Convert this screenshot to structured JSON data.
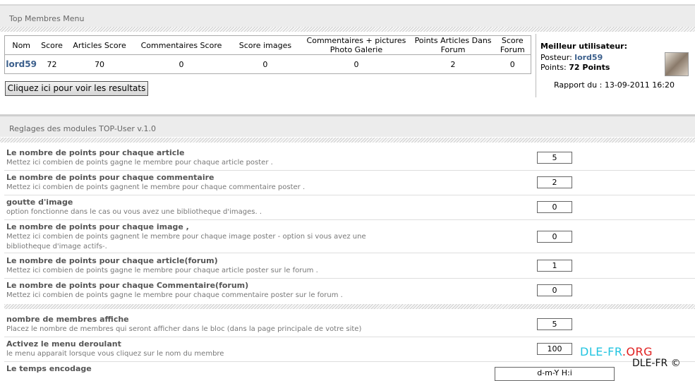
{
  "top_menu": {
    "title": "Top Membres Menu",
    "columns": [
      "Nom",
      "Score",
      "Articles Score",
      "Commentaires Score",
      "Score images",
      "Commentaires + pictures Photo Galerie",
      "Points Articles Dans Forum",
      "Score Forum"
    ],
    "rows": [
      [
        "lord59",
        "72",
        "70",
        "0",
        "0",
        "0",
        "2",
        "0"
      ]
    ],
    "results_button": "Cliquez ici pour voir les resultats",
    "best_user": {
      "heading": "Meilleur utilisateur:",
      "poster_label": "Posteur:",
      "poster_name": "lord59",
      "points_label": "Points:",
      "points_value": "72 Points",
      "report_label": "Rapport du : 13-09-2011 16:20"
    }
  },
  "settings": {
    "title": "Reglages des modules TOP-User v.1.0",
    "items": [
      {
        "label": "Le nombre de points pour chaque article",
        "desc": "Mettez ici combien de points gagne le membre pour chaque article poster .",
        "value": "5"
      },
      {
        "label": "Le nombre de points pour chaque commentaire",
        "desc": "Mettez ici combien de points gagnent le membre pour chaque commentaire poster .",
        "value": "2"
      },
      {
        "label": "goutte d'image",
        "desc": "option fonctionne dans le cas ou vous avez une bibliotheque d'images. .",
        "value": "0"
      },
      {
        "label": "Le nombre de points pour chaque image ,",
        "desc": "Mettez ici combien de points gagnent le membre pour chaque image poster - option si vous avez une bibliotheque d'image actifs-.",
        "value": "0"
      },
      {
        "label": "Le nombre de points pour chaque article(forum)",
        "desc": "Mettez ici combien de points gagne le membre pour chaque article poster sur le forum .",
        "value": "1"
      },
      {
        "label": "Le nombre de points pour chaque Commentaire(forum)",
        "desc": "Mettez ici combien de points gagne le membre pour chaque commentaire poster sur le forum .",
        "value": "0"
      }
    ],
    "items2": [
      {
        "label": "nombre de membres affiche",
        "desc": "Placez le nombre de membres qui seront afficher dans le bloc (dans la page principale de votre site)",
        "value": "5"
      },
      {
        "label": "Activez le menu deroulant",
        "desc": "le menu apparait lorsque vous cliquez sur le nom du membre",
        "value": "100"
      },
      {
        "label": "Le temps encodage",
        "desc": "",
        "value": "d-m-Y  H:i"
      }
    ]
  },
  "watermark": {
    "part1": "DLE-FR",
    "part2": ".ORG",
    "copyright": "DLE-FR ©",
    "color1": "#22c4e0",
    "color2": "#e02020"
  }
}
